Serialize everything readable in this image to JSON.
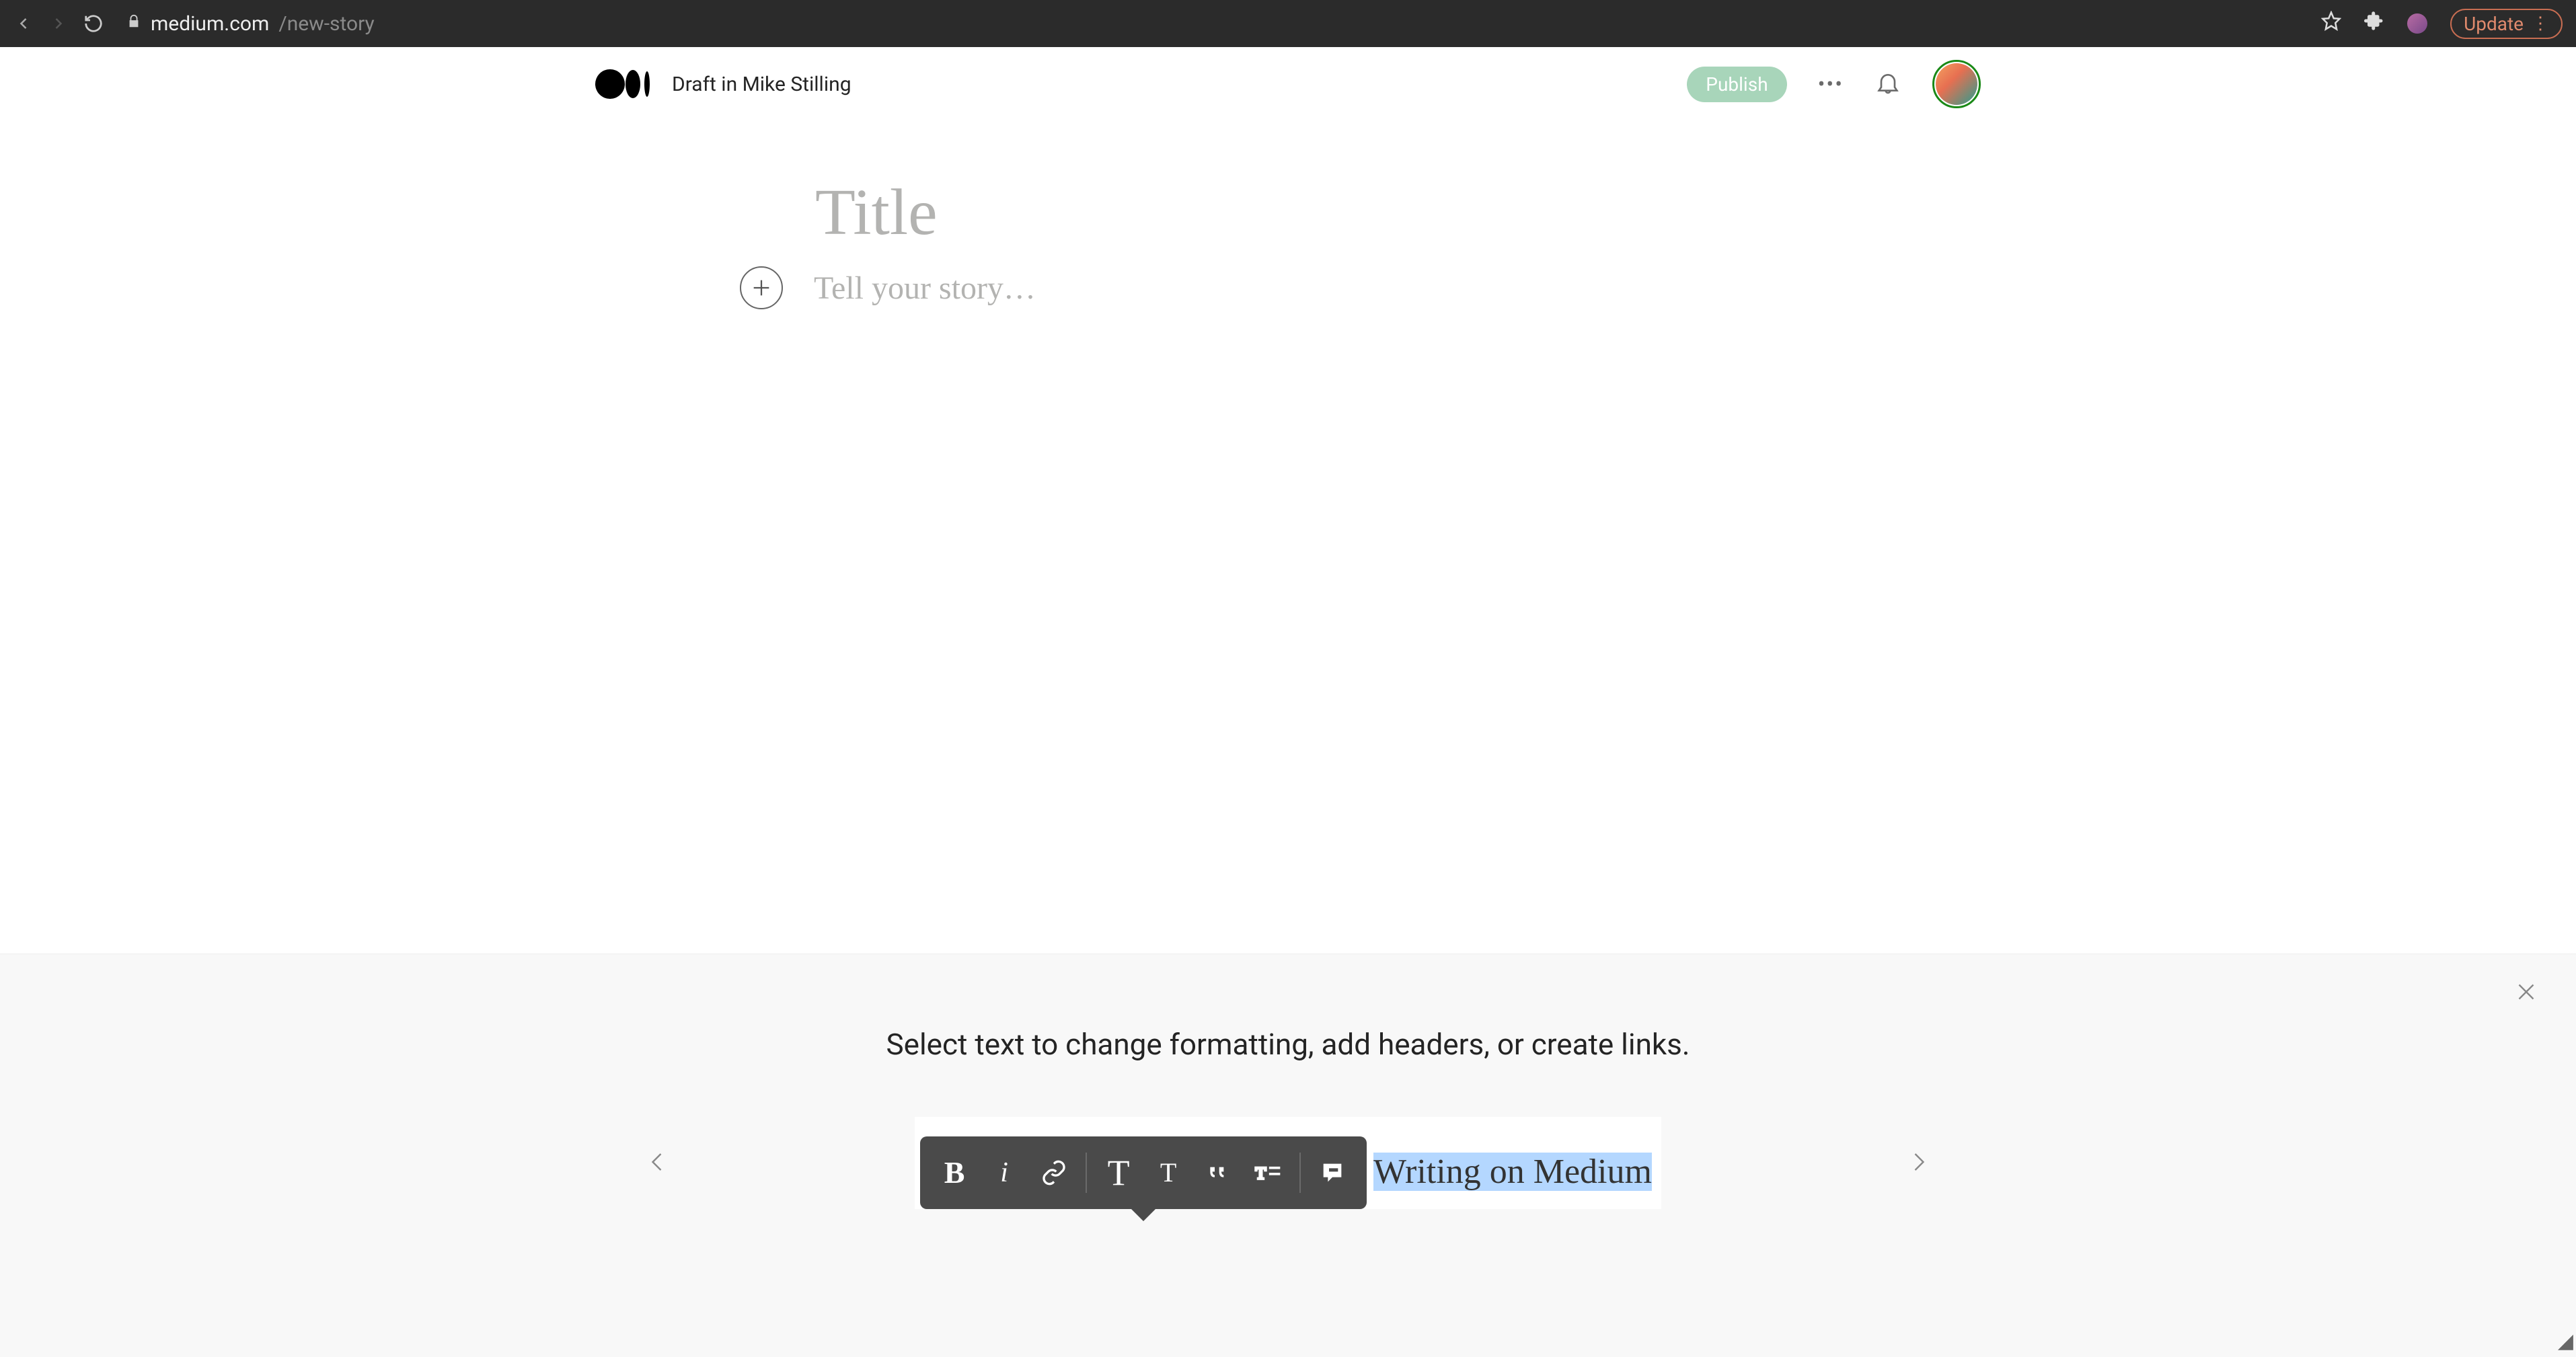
{
  "browser": {
    "url_domain": "medium.com",
    "url_path": "/new-story",
    "update_label": "Update"
  },
  "header": {
    "draft_label": "Draft in Mike Stilling",
    "publish_label": "Publish"
  },
  "editor": {
    "title_placeholder": "Title",
    "body_placeholder": "Tell your story…"
  },
  "onboard": {
    "tip": "Select text to change formatting, add headers, or create links.",
    "sample_text": "Writing on Medium",
    "toolbar": {
      "bold": "B",
      "italic": "i",
      "heading_large": "T",
      "heading_small": "T",
      "quote": "““"
    }
  }
}
